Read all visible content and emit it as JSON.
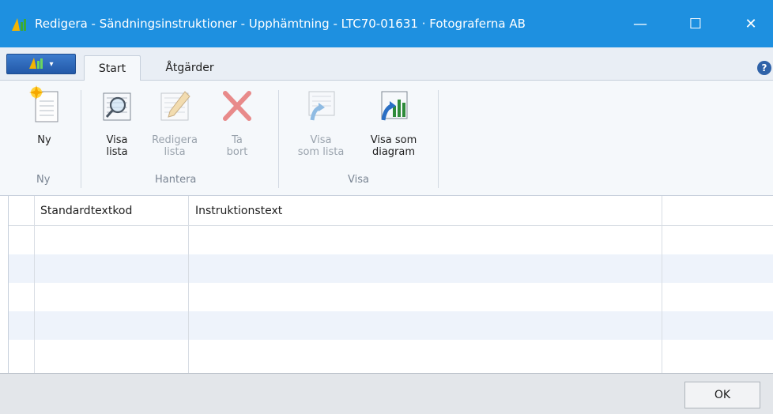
{
  "window": {
    "title": "Redigera - Sändningsinstruktioner - Upphämtning - LTC70-01631 · Fotograferna AB",
    "minimize_glyph": "—",
    "maximize_glyph": "☐",
    "close_glyph": "✕"
  },
  "ribbon": {
    "app_menu_caret": "▾",
    "tabs": [
      {
        "label": "Start",
        "active": true
      },
      {
        "label": "Åtgärder",
        "active": false
      }
    ],
    "help_glyph": "?",
    "groups": {
      "ny": "Ny",
      "hantera": "Hantera",
      "visa": "Visa"
    },
    "buttons": {
      "ny": {
        "line1": "Ny",
        "line2": "",
        "icon": "new-document-icon",
        "enabled": true
      },
      "visa_lista": {
        "line1": "Visa",
        "line2": "lista",
        "icon": "view-list-icon",
        "enabled": true
      },
      "redigera_lista": {
        "line1": "Redigera",
        "line2": "lista",
        "icon": "edit-list-icon",
        "enabled": false
      },
      "ta_bort": {
        "line1": "Ta",
        "line2": "bort",
        "icon": "delete-icon",
        "enabled": false
      },
      "visa_som_lista": {
        "line1": "Visa",
        "line2": "som lista",
        "icon": "show-as-list-icon",
        "enabled": false
      },
      "visa_som_diagram": {
        "line1": "Visa som",
        "line2": "diagram",
        "icon": "show-as-chart-icon",
        "enabled": true
      }
    }
  },
  "grid": {
    "columns": [
      "Standardtextkod",
      "Instruktionstext"
    ],
    "rows": [
      [
        "",
        ""
      ],
      [
        "",
        ""
      ],
      [
        "",
        ""
      ],
      [
        "",
        ""
      ],
      [
        "",
        ""
      ]
    ]
  },
  "footer": {
    "ok_label": "OK"
  },
  "colors": {
    "titlebar": "#1e90e0",
    "ribbon_bg": "#f5f8fb",
    "alt_row": "#eef3fb",
    "delete_red": "#e04848"
  }
}
